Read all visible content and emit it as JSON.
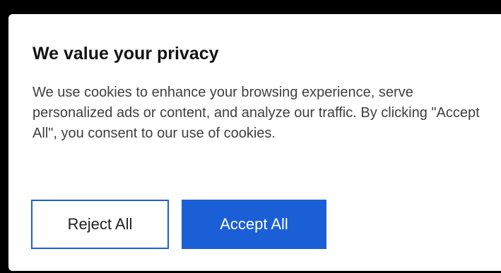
{
  "cookie_banner": {
    "title": "We value your privacy",
    "message": "We use cookies to enhance your browsing experience, serve personalized ads or content, and analyze our traffic. By clicking \"Accept All\", you consent to our use of cookies.",
    "reject_label": "Reject All",
    "accept_label": "Accept All"
  },
  "colors": {
    "accent": "#1a5fd6",
    "title_text": "#141414",
    "body_text": "#3f3f3f",
    "background": "#ffffff",
    "backdrop": "#000000"
  }
}
